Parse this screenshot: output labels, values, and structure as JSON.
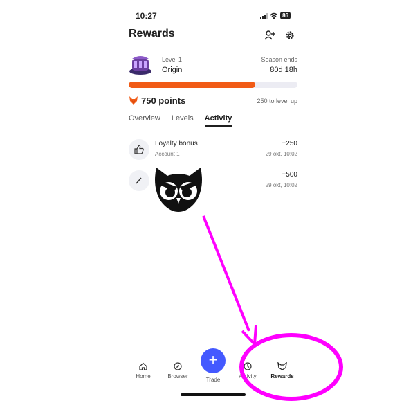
{
  "status_bar": {
    "time": "10:27",
    "battery": "86"
  },
  "header": {
    "title": "Rewards",
    "icons": [
      "add-user-icon",
      "settings-icon"
    ]
  },
  "level": {
    "label": "Level 1",
    "name": "Origin",
    "season_label": "Season ends",
    "season_value": "80d 18h"
  },
  "progress": {
    "fraction": 0.75,
    "color": "#f15b16"
  },
  "points": {
    "value": "750 points",
    "to_next_level": "250 to level up"
  },
  "tabs": [
    {
      "label": "Overview",
      "active": false
    },
    {
      "label": "Levels",
      "active": false
    },
    {
      "label": "Activity",
      "active": true
    }
  ],
  "activity": [
    {
      "title": "Loyalty bonus",
      "subtitle": "Account 1",
      "amount": "+250",
      "date": "29 okt, 10:02",
      "icon": "thumbs-up-icon"
    },
    {
      "title": "",
      "subtitle": "",
      "amount": "+500",
      "date": "29 okt, 10:02",
      "icon": "edit-icon"
    }
  ],
  "nav": {
    "items": [
      {
        "label": "Home",
        "icon": "home-icon"
      },
      {
        "label": "Browser",
        "icon": "compass-icon"
      },
      {
        "label": "Trade",
        "icon": "plus-icon"
      },
      {
        "label": "Activity",
        "icon": "clock-icon"
      },
      {
        "label": "Rewards",
        "icon": "fox-icon"
      }
    ],
    "trade_symbol": "+"
  },
  "annotation": {
    "color": "#ff00ff"
  }
}
